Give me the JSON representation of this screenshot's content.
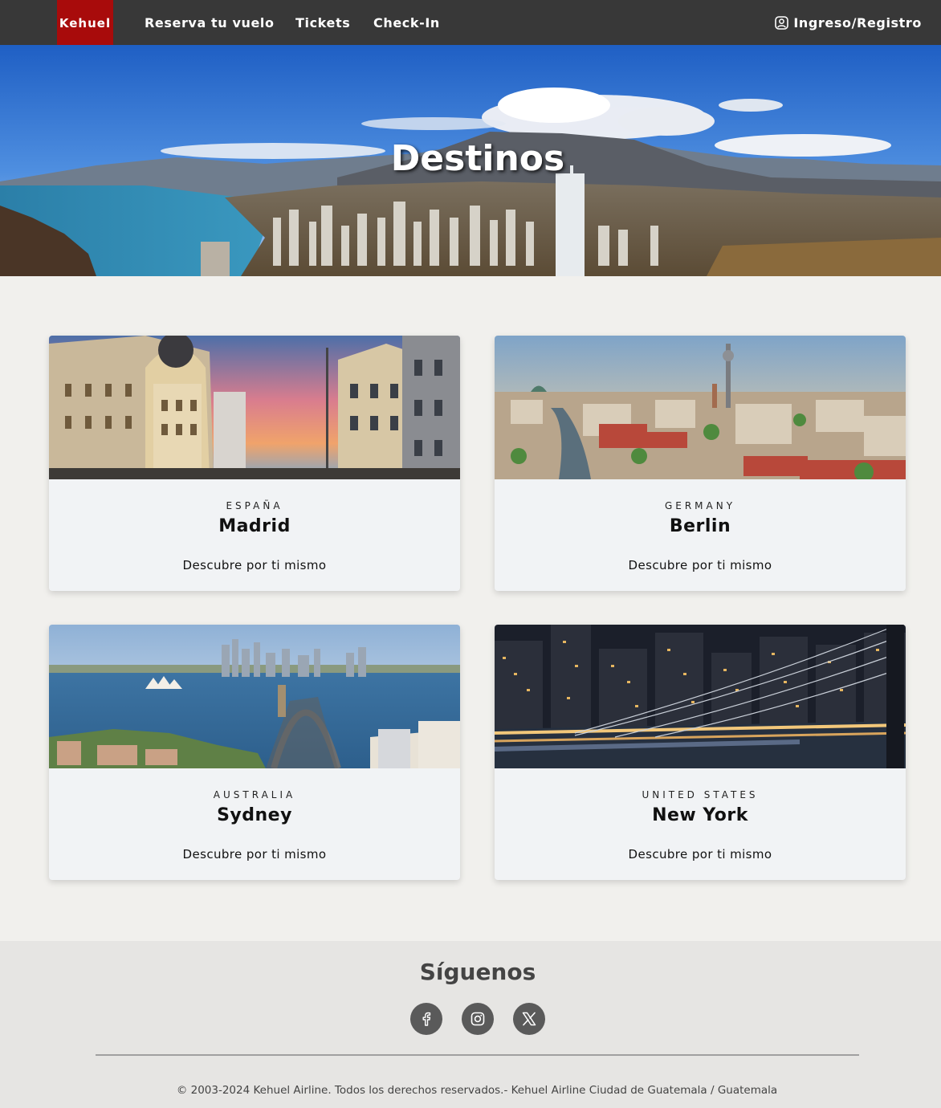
{
  "navbar": {
    "logo": "Kehuel",
    "links": [
      "Reserva tu vuelo",
      "Tickets",
      "Check-In"
    ],
    "login_label": "Ingreso/Registro",
    "login_icon": "user-circle-icon"
  },
  "hero": {
    "title": "Destinos"
  },
  "destinations": [
    {
      "country": "ESPAÑA",
      "city": "Madrid",
      "link": "Descubre por ti mismo"
    },
    {
      "country": "GERMANY",
      "city": "Berlin",
      "link": "Descubre por ti mismo"
    },
    {
      "country": "AUSTRALIA",
      "city": "Sydney",
      "link": "Descubre por ti mismo"
    },
    {
      "country": "UNITED STATES",
      "city": "New York",
      "link": "Descubre por ti mismo"
    }
  ],
  "footer": {
    "title": "Síguenos",
    "socials": [
      "facebook-icon",
      "instagram-icon",
      "x-icon"
    ],
    "copyright": "© 2003-2024 Kehuel Airline. Todos los derechos reservados.- Kehuel Airline Ciudad de Guatemala / Guatemala"
  },
  "colors": {
    "navbar": "#383838",
    "logo_bg": "#a80b0b",
    "page_bg": "#f1f0ed",
    "card_bg": "#f1f3f5",
    "footer_bg": "#e6e5e3",
    "social_bg": "#5a5a5a"
  }
}
